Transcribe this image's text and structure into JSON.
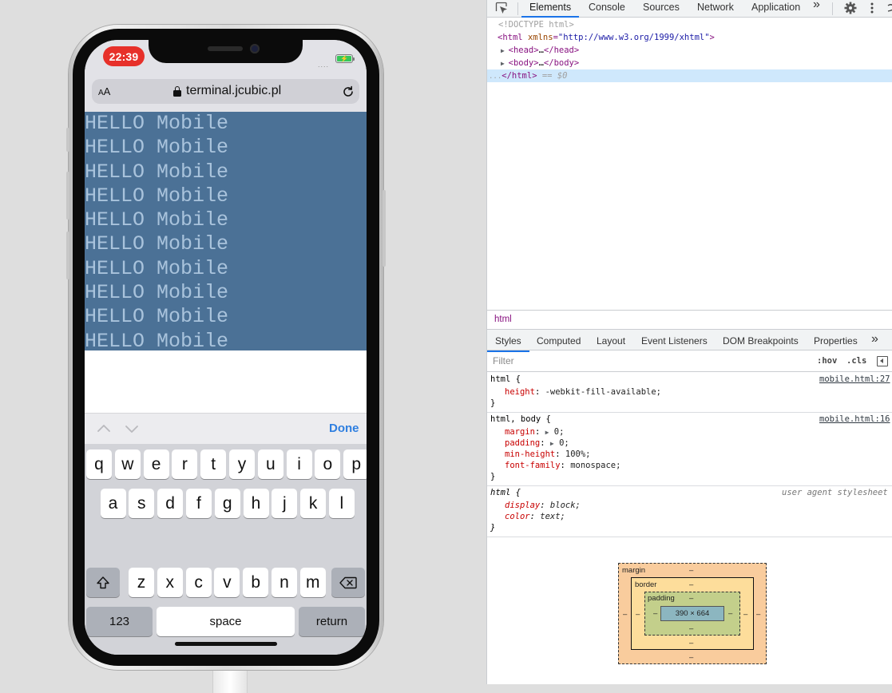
{
  "phone": {
    "status": {
      "time": "22:39",
      "signal": "....",
      "battery_glyph": "⚡"
    },
    "browser": {
      "aa_label_big": "A",
      "aa_label_small": "A",
      "url": "terminal.jcubic.pl"
    },
    "terminal": {
      "lines": [
        "HELLO Mobile",
        "HELLO Mobile",
        "HELLO Mobile",
        "HELLO Mobile",
        "HELLO Mobile",
        "HELLO Mobile",
        "HELLO Mobile",
        "HELLO Mobile",
        "HELLO Mobile",
        "HELLO Mobile"
      ],
      "bg_color": "#4b7196",
      "text_color": "#a9c3dc"
    },
    "accessory": {
      "done_label": "Done"
    },
    "keyboard": {
      "row1": [
        "q",
        "w",
        "e",
        "r",
        "t",
        "y",
        "u",
        "i",
        "o",
        "p"
      ],
      "row2": [
        "a",
        "s",
        "d",
        "f",
        "g",
        "h",
        "j",
        "k",
        "l"
      ],
      "row3": [
        "z",
        "x",
        "c",
        "v",
        "b",
        "n",
        "m"
      ],
      "numbers_label": "123",
      "space_label": "space",
      "return_label": "return"
    }
  },
  "devtools": {
    "tabs": [
      "Elements",
      "Console",
      "Sources",
      "Network",
      "Application"
    ],
    "more_tabs_glyph": "»",
    "dom": {
      "doctype": "<!DOCTYPE html>",
      "html_open_tag": "html",
      "html_attr_name": "xmlns",
      "html_attr_value": "\"http://www.w3.org/1999/xhtml\"",
      "head_tag": "head",
      "body_tag": "body",
      "ellipsis": "…",
      "html_close": "</html>",
      "selected_marker": "== $0",
      "dots": "..."
    },
    "breadcrumb": "html",
    "subtabs": [
      "Styles",
      "Computed",
      "Layout",
      "Event Listeners",
      "DOM Breakpoints",
      "Properties"
    ],
    "filter_placeholder": "Filter",
    "hov_label": ":hov",
    "cls_label": ".cls",
    "rules": [
      {
        "selector": "html {",
        "source": "mobile.html:27",
        "decls": [
          {
            "name": "height",
            "value": "-webkit-fill-available;"
          }
        ]
      },
      {
        "selector": "html, body {",
        "source": "mobile.html:16",
        "decls": [
          {
            "name": "margin",
            "value": "0;",
            "expander": "▶"
          },
          {
            "name": "padding",
            "value": "0;",
            "expander": "▶"
          },
          {
            "name": "min-height",
            "value": "100%;"
          },
          {
            "name": "font-family",
            "value": "monospace;"
          }
        ]
      },
      {
        "selector": "html {",
        "source": "user agent stylesheet",
        "decls": [
          {
            "name": "display",
            "value": "block;"
          },
          {
            "name": "color",
            "value": "text;"
          }
        ]
      }
    ],
    "closing_brace": "}",
    "box_model": {
      "margin_label": "margin",
      "border_label": "border",
      "padding_label": "padding",
      "content_size": "390 × 664",
      "dash": "–"
    }
  }
}
